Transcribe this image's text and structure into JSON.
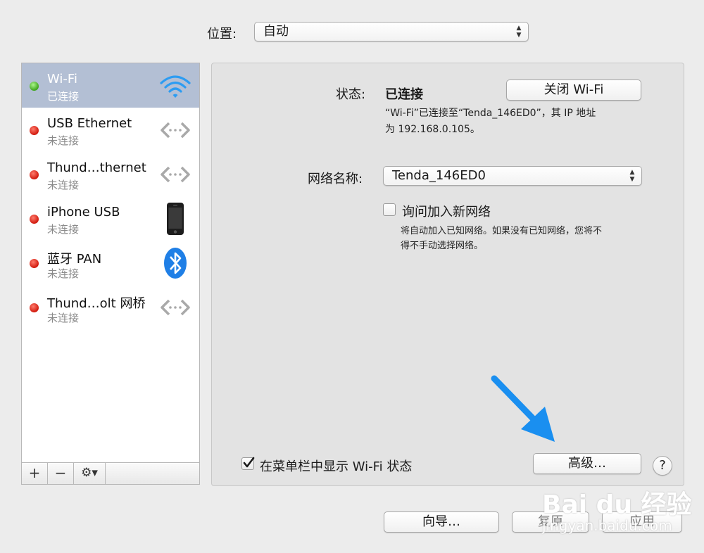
{
  "location": {
    "label": "位置:",
    "value": "自动"
  },
  "services": [
    {
      "name": "Wi-Fi",
      "status": "已连接",
      "connected": true,
      "icon": "wifi-icon"
    },
    {
      "name": "USB Ethernet",
      "status": "未连接",
      "connected": false,
      "icon": "ethernet-icon"
    },
    {
      "name": "Thund…thernet",
      "status": "未连接",
      "connected": false,
      "icon": "ethernet-icon"
    },
    {
      "name": "iPhone USB",
      "status": "未连接",
      "connected": false,
      "icon": "iphone-icon"
    },
    {
      "name": "蓝牙 PAN",
      "status": "未连接",
      "connected": false,
      "icon": "bluetooth-icon"
    },
    {
      "name": "Thund…olt 网桥",
      "status": "未连接",
      "connected": false,
      "icon": "ethernet-icon"
    }
  ],
  "sidebar_toolbar": {
    "add": "+",
    "remove": "−",
    "gear": "⚙▾"
  },
  "detail": {
    "status_label": "状态:",
    "status_value": "已连接",
    "turn_off_button": "关闭 Wi-Fi",
    "status_desc_line1": "“Wi-Fi”已连接至“Tenda_146ED0”，其 IP 地址",
    "status_desc_line2": "为 192.168.0.105。",
    "network_name_label": "网络名称:",
    "network_name_value": "Tenda_146ED0",
    "ask_join_label": "询问加入新网络",
    "ask_join_checked": false,
    "ask_join_desc_line1": "将自动加入已知网络。如果没有已知网络，您将不",
    "ask_join_desc_line2": "得不手动选择网络。",
    "show_wifi_label": "在菜单栏中显示 Wi-Fi 状态",
    "show_wifi_checked": true,
    "advanced_button": "高级…",
    "help_button": "?"
  },
  "bottom": {
    "assist_button": "向导…",
    "revert_button": "复原",
    "apply_button": "应用"
  },
  "watermark": {
    "brand": "Bai du 经验",
    "url": "jingyan.baidu.com"
  },
  "colors": {
    "selection": "#b3bfd4",
    "wifi_blue": "#2c9cf2",
    "arrow_blue": "#1a8ff0",
    "status_red": "#d11a0e",
    "status_green": "#3ea51d"
  }
}
